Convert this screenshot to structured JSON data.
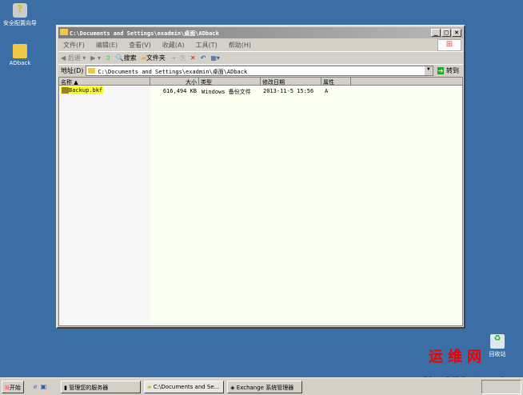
{
  "desktop": {
    "icons": [
      {
        "label": "安全配置向导"
      },
      {
        "label": "ADback"
      },
      {
        "label": "回收站"
      }
    ]
  },
  "window": {
    "title": "C:\\Documents and Settings\\exadmin\\桌面\\ADback",
    "menu": [
      "文件(F)",
      "编辑(E)",
      "查看(V)",
      "收藏(A)",
      "工具(T)",
      "帮助(H)"
    ],
    "toolbar": {
      "back": "后退",
      "search": "搜索",
      "folders": "文件夹"
    },
    "address": {
      "label": "地址(D)",
      "value": "C:\\Documents and Settings\\exadmin\\桌面\\ADback",
      "go": "转到"
    },
    "columns": [
      "名称",
      "大小",
      "类型",
      "修改日期",
      "属性"
    ],
    "files": [
      {
        "name": "Backup.bkf",
        "size": "616,494 KB",
        "type": "Windows 备份文件",
        "modified": "2013-11-5 15:56",
        "attr": "A"
      }
    ]
  },
  "taskbar": {
    "start": "开始",
    "tasks": [
      "管理您的服务器",
      "C:\\Documents and Se...",
      "Exchange 系统管理器"
    ]
  },
  "watermark": {
    "cn": "运维网",
    "en": "YunVNetwork"
  }
}
